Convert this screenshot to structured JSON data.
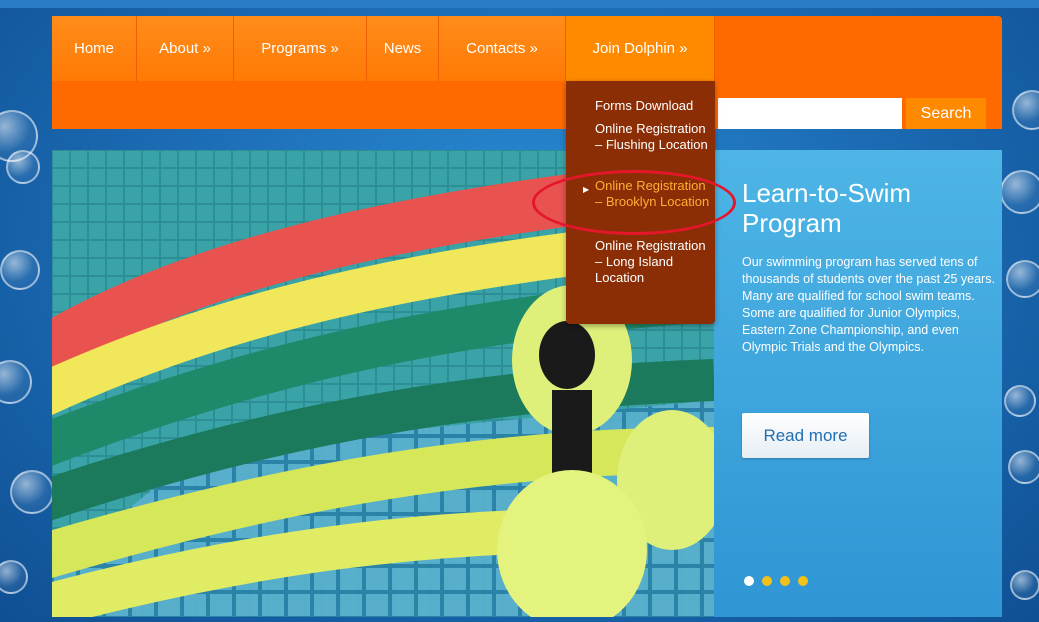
{
  "nav": {
    "items": [
      {
        "label": "Home"
      },
      {
        "label": "About »"
      },
      {
        "label": "Programs »"
      },
      {
        "label": "News"
      },
      {
        "label": "Contacts »"
      },
      {
        "label": "Join Dolphin »"
      }
    ]
  },
  "search": {
    "button_label": "Search",
    "value": ""
  },
  "dropdown": {
    "items": [
      {
        "label": "Forms Download"
      },
      {
        "label": "Online Registration – Flushing Location"
      },
      {
        "label": "Online Registration – Brooklyn Location"
      },
      {
        "label": "Online Registration – Long Island Location"
      }
    ]
  },
  "slide": {
    "title": "Learn-to-Swim Program",
    "text": "Our swimming program has served tens of thousands of students over the past 25 years. Many are qualified for school swim teams. Some are qualified for Junior Olympics, Eastern Zone Championship, and even Olympic Trials and the Olympics.",
    "read_more_label": "Read more"
  },
  "slider": {
    "slide_count": 4,
    "active_index": 0
  },
  "colors": {
    "nav": "#ff6a00",
    "dropdown": "#8b2e06",
    "active_item": "#ffad33",
    "annotation": "#e4162a"
  }
}
